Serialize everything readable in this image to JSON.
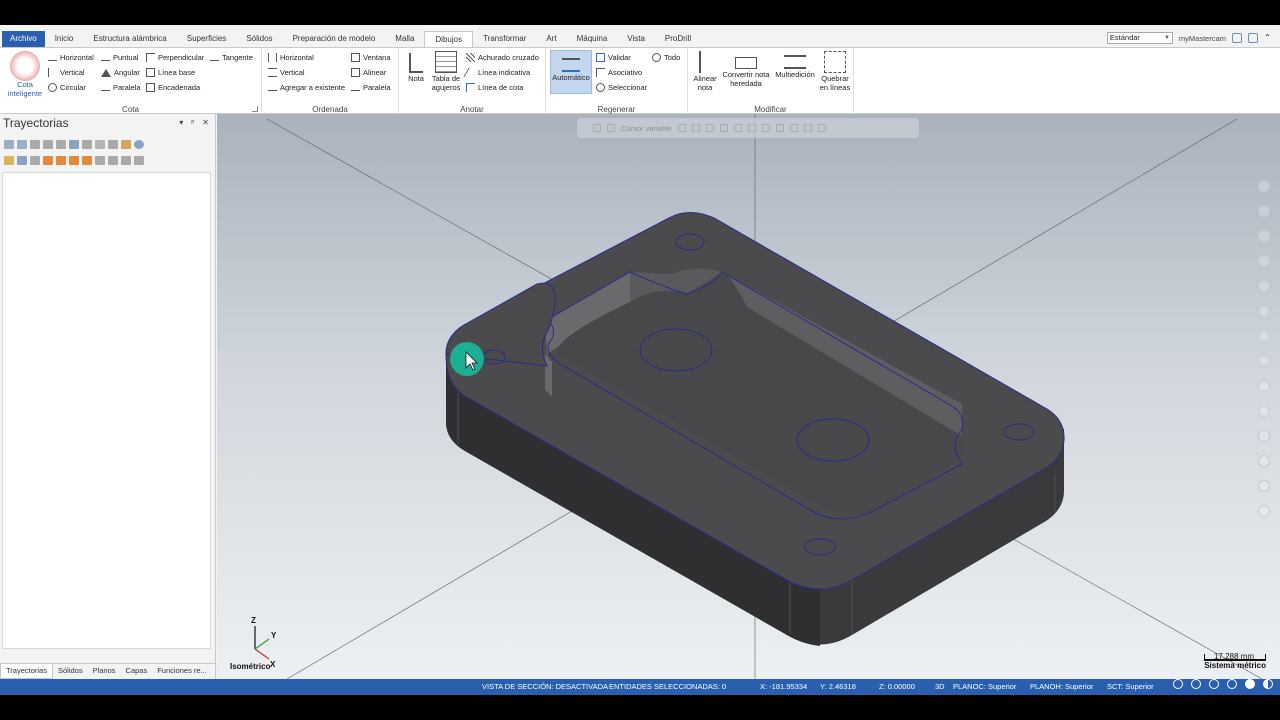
{
  "tabs": [
    "Archivo",
    "Inicio",
    "Estructura alámbrica",
    "Superficies",
    "Sólidos",
    "Preparación de modelo",
    "Malla",
    "Dibujos",
    "Transformar",
    "Art",
    "Máquina",
    "Vista",
    "ProDrill"
  ],
  "active_tab": "Dibujos",
  "top_right": {
    "style_select": "Estándar",
    "account": "myMastercam"
  },
  "ribbon": {
    "cota": {
      "label": "Cota",
      "smart_dimension": "Cota inteligente",
      "col1": [
        "Horizontal",
        "Vertical",
        "Circular"
      ],
      "col2": [
        "Puntual",
        "Angular",
        "Paralela"
      ],
      "col3": [
        "Perpendicular",
        "Línea base",
        "Encadenada"
      ],
      "col4": [
        "Tangente"
      ]
    },
    "ordenada": {
      "label": "Ordenada",
      "col1": [
        "Horizontal",
        "Vertical",
        "Agregar a existente"
      ],
      "col2": [
        "Ventana",
        "Alinear",
        "Paralela"
      ]
    },
    "anotar": {
      "label": "Anotar",
      "nota": "Nota",
      "tabla": "Tabla de agujeros",
      "items": [
        "Achurado cruzado",
        "Línea indicativa",
        "Línea de cota"
      ]
    },
    "regenerar": {
      "label": "Regenerar",
      "automatico": "Automático",
      "col1": [
        "Validar",
        "Asociativo",
        "Seleccionar"
      ],
      "col2": [
        "Todo"
      ]
    },
    "modificar": {
      "label": "Modificar",
      "buttons": [
        "Alinear nota",
        "Convertir nota heredada",
        "Multiedición",
        "Quebrar en líneas"
      ]
    }
  },
  "panel": {
    "title": "Trayectorias",
    "bottom_tabs": [
      "Trayectorias",
      "Sólidos",
      "Planos",
      "Capas",
      "Funciones re..."
    ]
  },
  "viewport": {
    "floating_toolbar_text": "Cursor variable",
    "view_name": "Isométrico",
    "scale_value": "17.288 mm",
    "scale_unit": "Sistema métrico",
    "axis_labels": {
      "z": "Z",
      "y": "Y",
      "x": "X"
    }
  },
  "status": {
    "section_view": "VISTA DE SECCIÓN: DESACTIVADA",
    "selected": "ENTIDADES SELECCIONADAS: 0",
    "x": "X:   -181.95334",
    "y": "Y:   2.46318",
    "z": "Z:   0.00000",
    "mode": "3D",
    "planoc": "PLANOC: Superior",
    "planoh": "PLANOH: Superior",
    "sct": "SCT: Superior"
  },
  "colors": {
    "accent": "#2a5fb0",
    "part_top": "#4b4b4d",
    "part_side": "#3a3a3c",
    "edge": "#2a2a8c",
    "cursor_highlight": "#19b79a"
  }
}
